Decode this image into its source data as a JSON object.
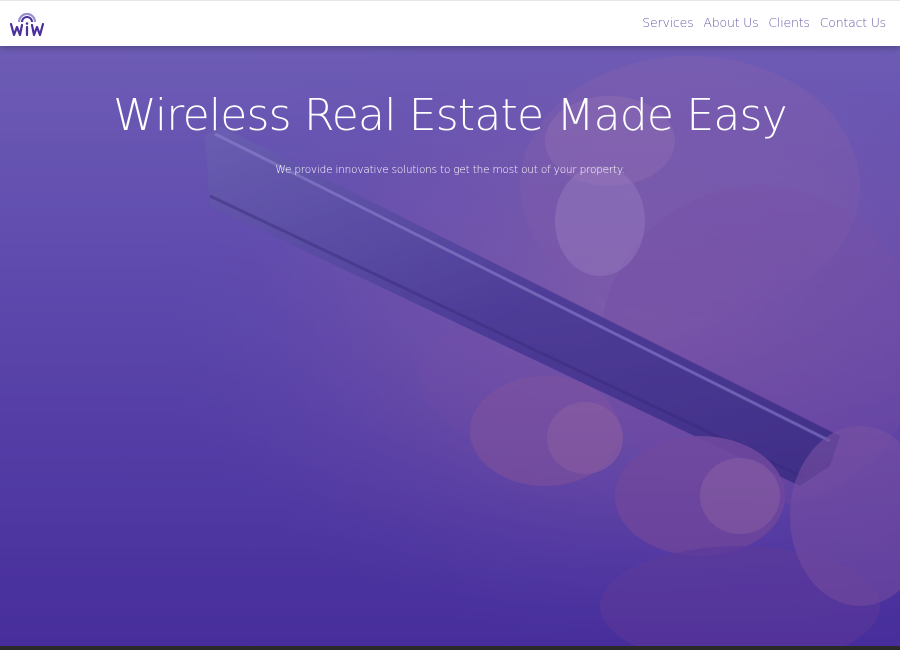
{
  "header": {
    "logo_alt": "WiW",
    "nav": [
      {
        "label": "Services"
      },
      {
        "label": "About Us"
      },
      {
        "label": "Clients"
      },
      {
        "label": "Contact Us"
      }
    ]
  },
  "hero": {
    "title": "Wireless Real Estate Made Easy",
    "subtitle": "We provide innovative solutions to get the most out of your property."
  },
  "colors": {
    "brand": "#4a2f9d",
    "nav_text": "#6a5aa8",
    "overlay": "#5b46ad"
  }
}
